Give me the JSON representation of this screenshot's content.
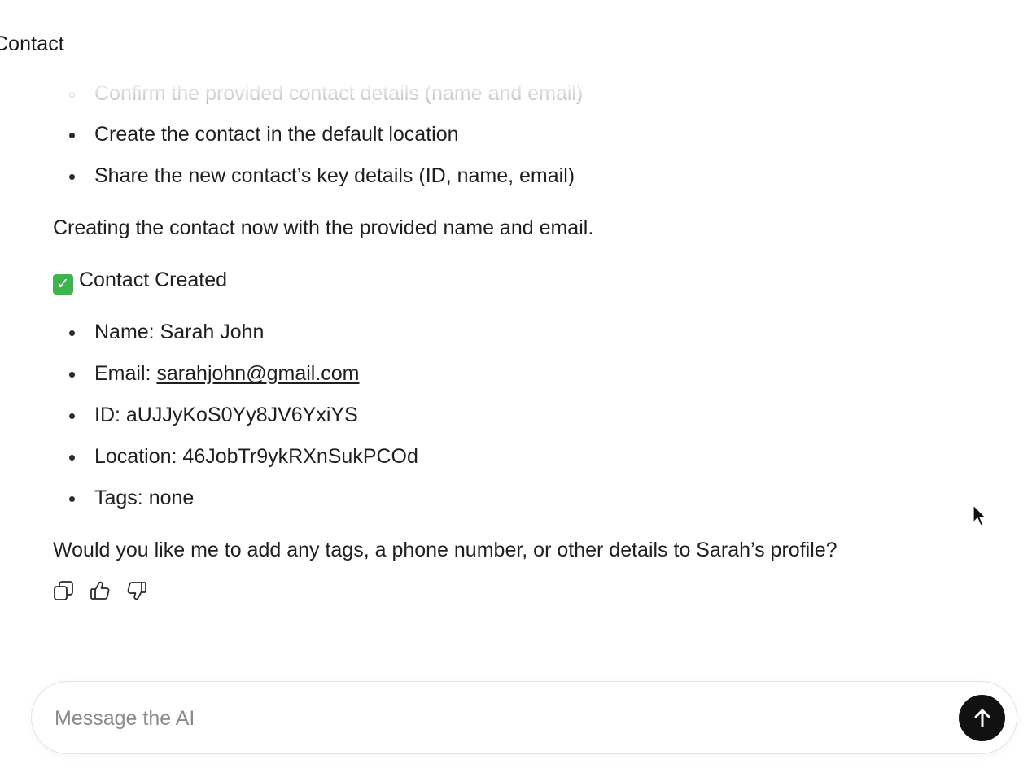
{
  "header": {
    "title": "Contact"
  },
  "message": {
    "plan_steps": [
      "Confirm the provided contact details (name and email)",
      "Create the contact in the default location",
      "Share the new contact’s key details (ID, name, email)"
    ],
    "status_line": "Creating the contact now with the provided name and email.",
    "result_heading": "Contact Created",
    "result_heading_icon": "check-mark-button-emoji",
    "details": {
      "name_label": "Name: ",
      "name_value": "Sarah John",
      "email_label": "Email: ",
      "email_value": "sarahjohn@gmail.com",
      "id_label": "ID: ",
      "id_value": "aUJJyKoS0Yy8JV6YxiYS",
      "location_label": "Location: ",
      "location_value": "46JobTr9ykRXnSukPCOd",
      "tags_label": "Tags: ",
      "tags_value": "none"
    },
    "follow_up": "Would you like me to add any tags, a phone number, or other details to Sarah’s profile?",
    "actions": [
      "copy-icon",
      "thumbs-up-icon",
      "thumbs-down-icon"
    ]
  },
  "composer": {
    "placeholder": "Message the AI",
    "value": "",
    "send_icon": "arrow-up-icon"
  },
  "colors": {
    "send_button": "#111111",
    "check_emoji": "#3fb34f"
  }
}
